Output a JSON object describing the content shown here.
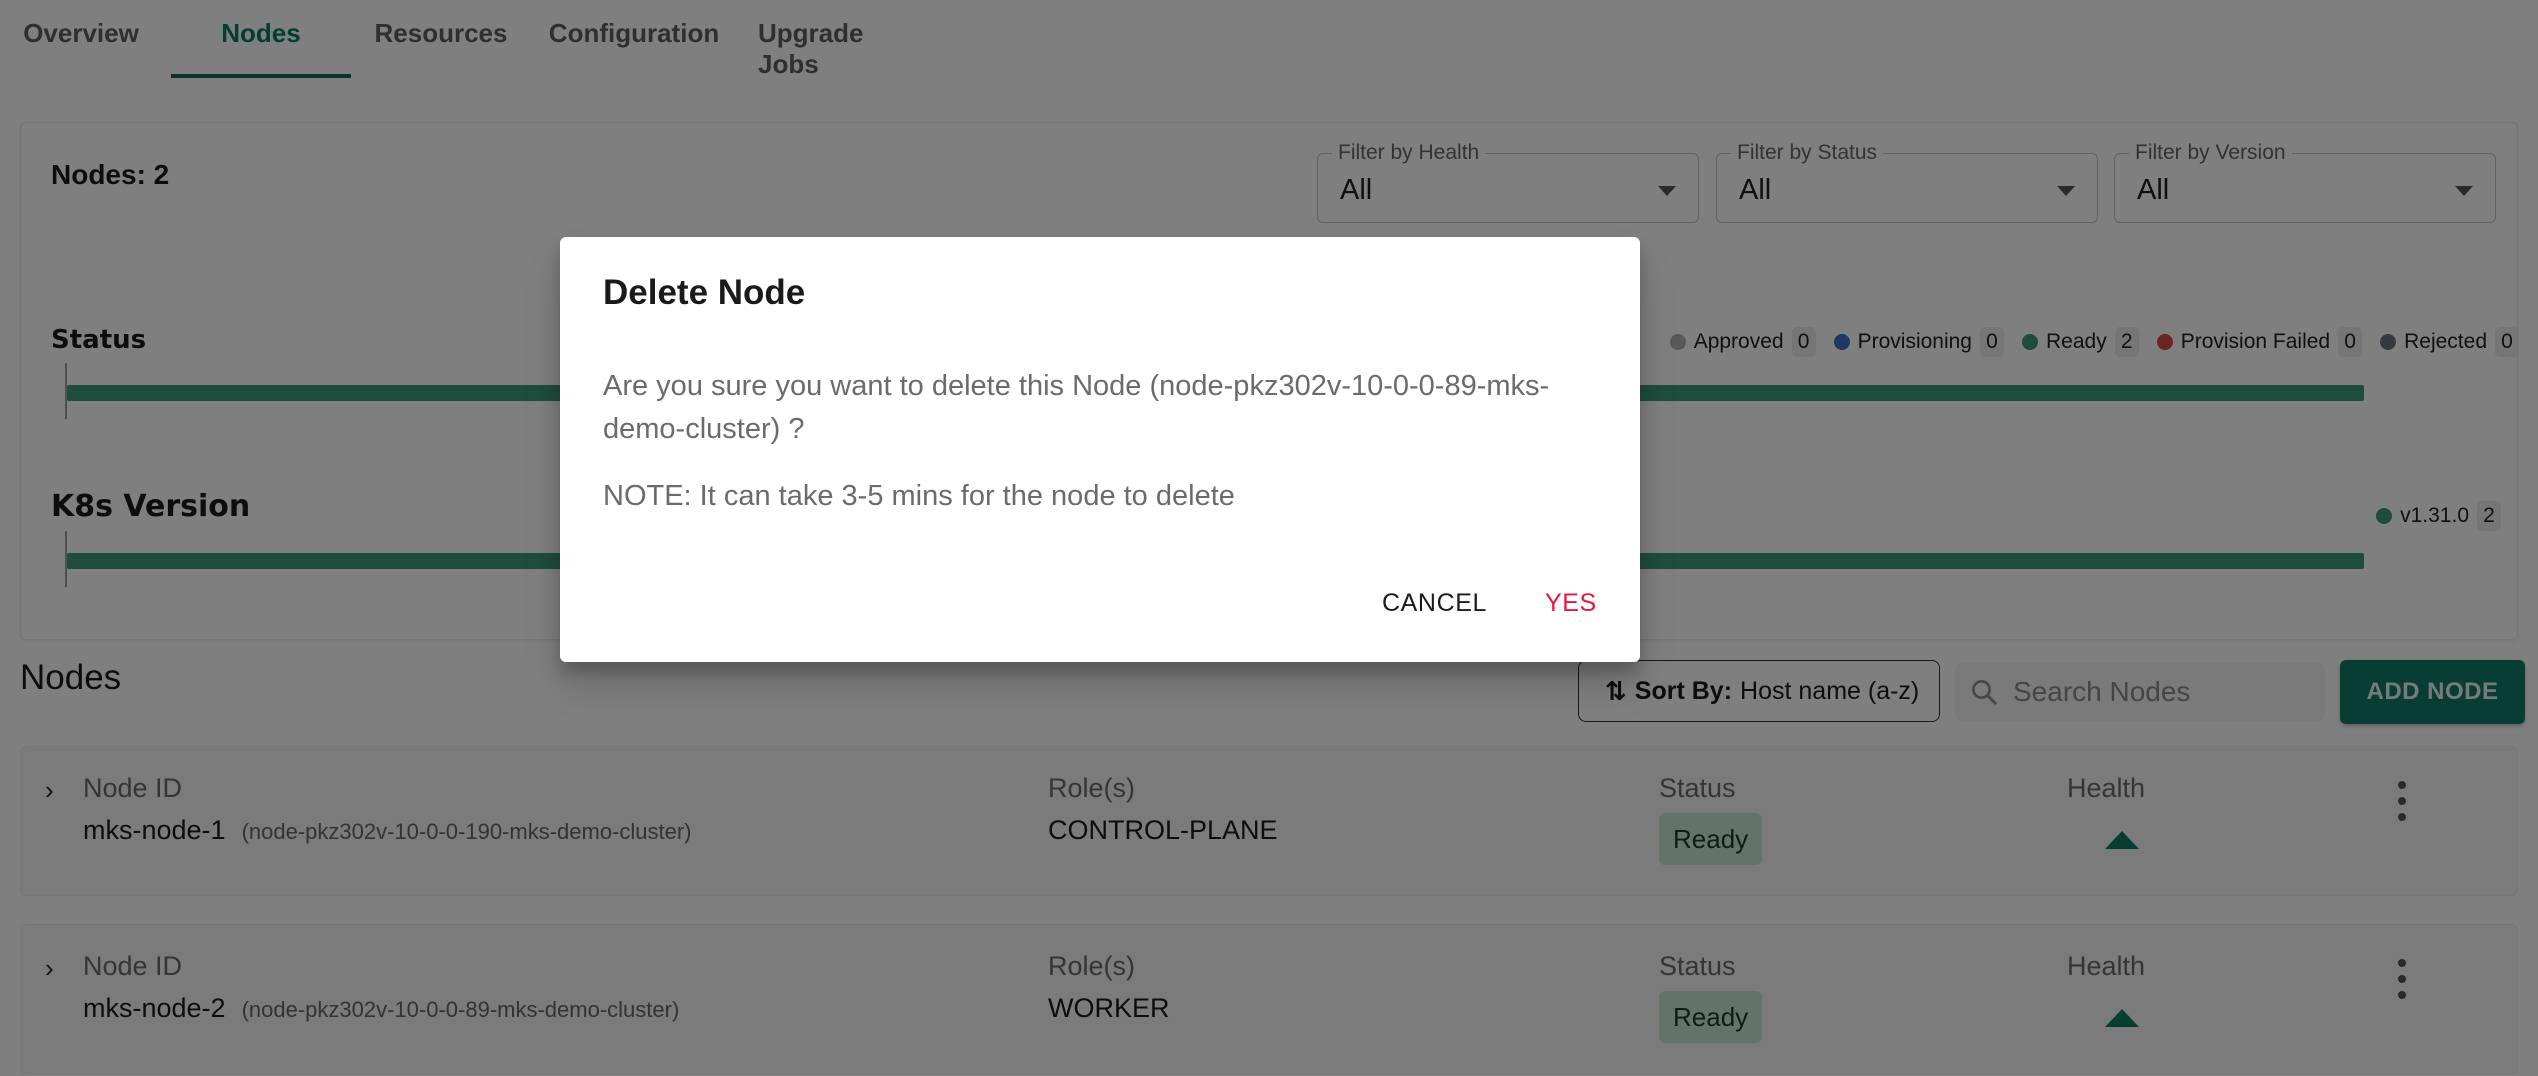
{
  "tabs": [
    {
      "label": "Overview",
      "active": false
    },
    {
      "label": "Nodes",
      "active": true
    },
    {
      "label": "Resources",
      "active": false
    },
    {
      "label": "Configuration",
      "active": false
    },
    {
      "label": "Upgrade Jobs",
      "active": false
    }
  ],
  "summary": {
    "nodes_count_label": "Nodes: 2",
    "filters": [
      {
        "label": "Filter by Health",
        "value": "All"
      },
      {
        "label": "Filter by Status",
        "value": "All"
      },
      {
        "label": "Filter by Version",
        "value": "All"
      }
    ],
    "status": {
      "title": "Status",
      "legend": [
        {
          "label": "Approved",
          "count": "0",
          "color": "#b0b0b0"
        },
        {
          "label": "Provisioning",
          "count": "0",
          "color": "#3f6fc4"
        },
        {
          "label": "Ready",
          "count": "2",
          "color": "#3d9a7b"
        },
        {
          "label": "Provision Failed",
          "count": "0",
          "color": "#d64b4b"
        },
        {
          "label": "Rejected",
          "count": "0",
          "color": "#6b7280"
        }
      ],
      "ready_fraction": 1.0
    },
    "k8s_version": {
      "title": "K8s Version",
      "legend": [
        {
          "label": "v1.31.0",
          "count": "2",
          "color": "#3d9a7b"
        }
      ],
      "fraction": 1.0
    }
  },
  "nodes_section": {
    "heading": "Nodes",
    "sort_prefix": "Sort By:",
    "sort_value": "Host name (a-z)",
    "search_placeholder": "Search Nodes",
    "search_value": "",
    "add_button": "ADD NODE",
    "columns": {
      "node_id": "Node ID",
      "roles": "Role(s)",
      "status": "Status",
      "health": "Health"
    },
    "rows": [
      {
        "host": "mks-node-1",
        "full_id": "(node-pkz302v-10-0-0-190-mks-demo-cluster)",
        "role": "CONTROL-PLANE",
        "status": "Ready",
        "health": "healthy"
      },
      {
        "host": "mks-node-2",
        "full_id": "(node-pkz302v-10-0-0-89-mks-demo-cluster)",
        "role": "WORKER",
        "status": "Ready",
        "health": "healthy"
      }
    ]
  },
  "dialog": {
    "title": "Delete Node",
    "message": "Are you sure you want to delete this Node (node-pkz302v-10-0-0-89-mks-demo-cluster) ?",
    "note": "NOTE: It can take 3-5 mins for the node to delete",
    "cancel_label": "CANCEL",
    "confirm_label": "YES"
  },
  "colors": {
    "accent": "#0e7a66",
    "danger": "#e8173b",
    "ready": "#3d9a7b"
  }
}
